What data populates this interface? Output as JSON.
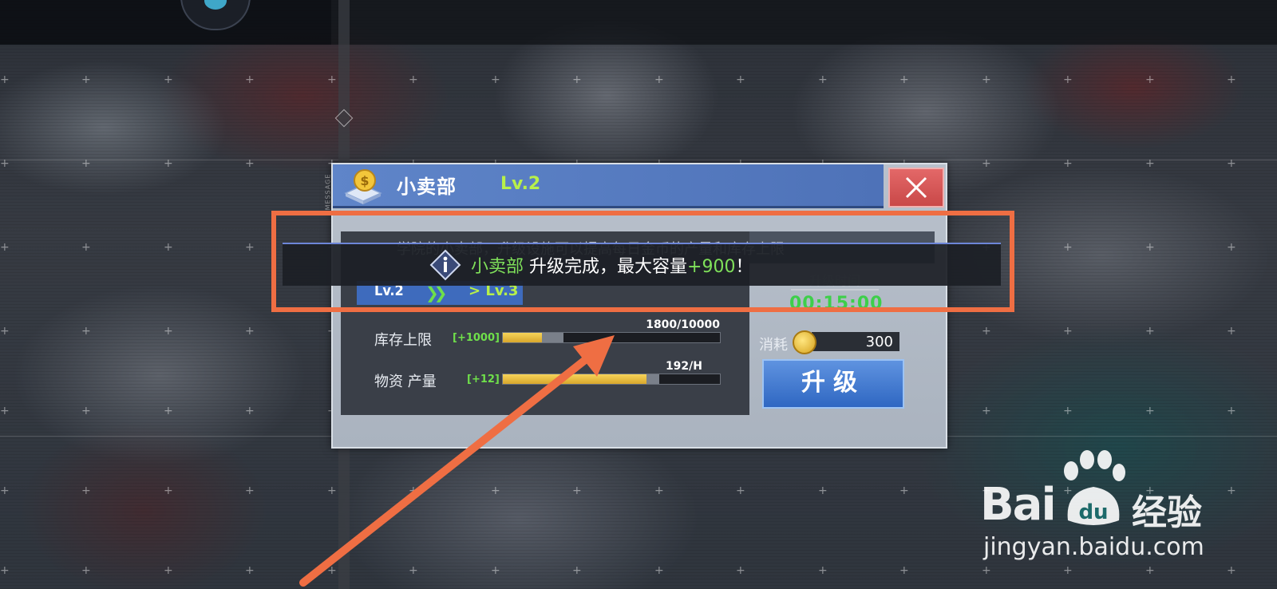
{
  "panel": {
    "title": "小卖部",
    "level": "Lv.2",
    "description": "学院的小卖部，升级设施可以提高每日金币的产量和库存上限",
    "level_from": "Lv.2",
    "level_to": "> Lv.3",
    "rows": [
      {
        "label": "库存上限",
        "bonus": "[+1000]",
        "value_text": "1800/10000",
        "fill": 0.18,
        "prev_fill": 0.28
      },
      {
        "label": "物资 产量",
        "bonus": "[+12]",
        "value_text": "192/H",
        "fill": 0.66,
        "prev_fill": 0.72
      }
    ],
    "upgrade_time_label": "升级时间",
    "upgrade_time": "00:15:00",
    "cost_label": "消耗",
    "cost_value": "300",
    "upgrade_button": "升级"
  },
  "notice": {
    "building": "小卖部",
    "text_a": " 升级完成，最大容量",
    "amount": "+900",
    "text_b": "！"
  },
  "sidebar_tag": "MESSAGE",
  "watermark": {
    "brand": "Bai",
    "brand_cn": "经验",
    "url": "jingyan.baidu.com"
  },
  "colors": {
    "highlight_green": "#7fe05a",
    "annotation_orange": "#ef6e43",
    "title_blue": "#5f85c9",
    "close_red": "#d95656"
  }
}
